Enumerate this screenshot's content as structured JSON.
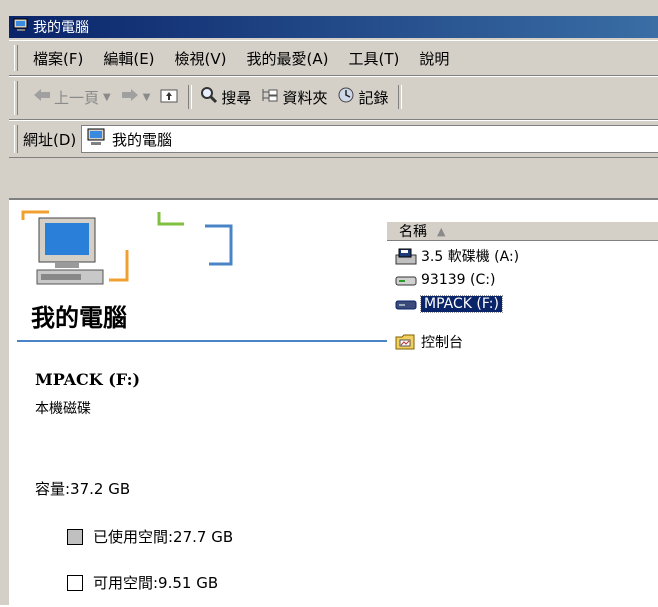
{
  "window": {
    "title": "我的電腦"
  },
  "menu": [
    "檔案(F)",
    "編輯(E)",
    "檢視(V)",
    "我的最愛(A)",
    "工具(T)",
    "說明"
  ],
  "toolbar": {
    "back": "上一頁",
    "search": "搜尋",
    "folders": "資料夾",
    "history": "記錄"
  },
  "address": {
    "label": "網址(D)",
    "value": "我的電腦"
  },
  "left_panel": {
    "title": "我的電腦",
    "drive_name": "MPACK (F:)",
    "drive_type": "本機磁碟",
    "capacity": "容量:37.2 GB",
    "used": "已使用空間:27.7 GB",
    "free": "可用空間:9.51 GB"
  },
  "list": {
    "header": "名稱",
    "items": [
      {
        "name": "3.5 軟碟機 (A:)",
        "icon": "floppy-drive-icon"
      },
      {
        "name": "93139 (C:)",
        "icon": "hard-drive-icon"
      },
      {
        "name": "MPACK (F:)",
        "icon": "hard-drive-icon",
        "selected": true
      },
      {
        "name": "控制台",
        "icon": "control-panel-icon"
      }
    ]
  },
  "colors": {
    "title_bar": "#0a246a",
    "accent_line": "#4a84c6",
    "selection": "#0a246a"
  }
}
